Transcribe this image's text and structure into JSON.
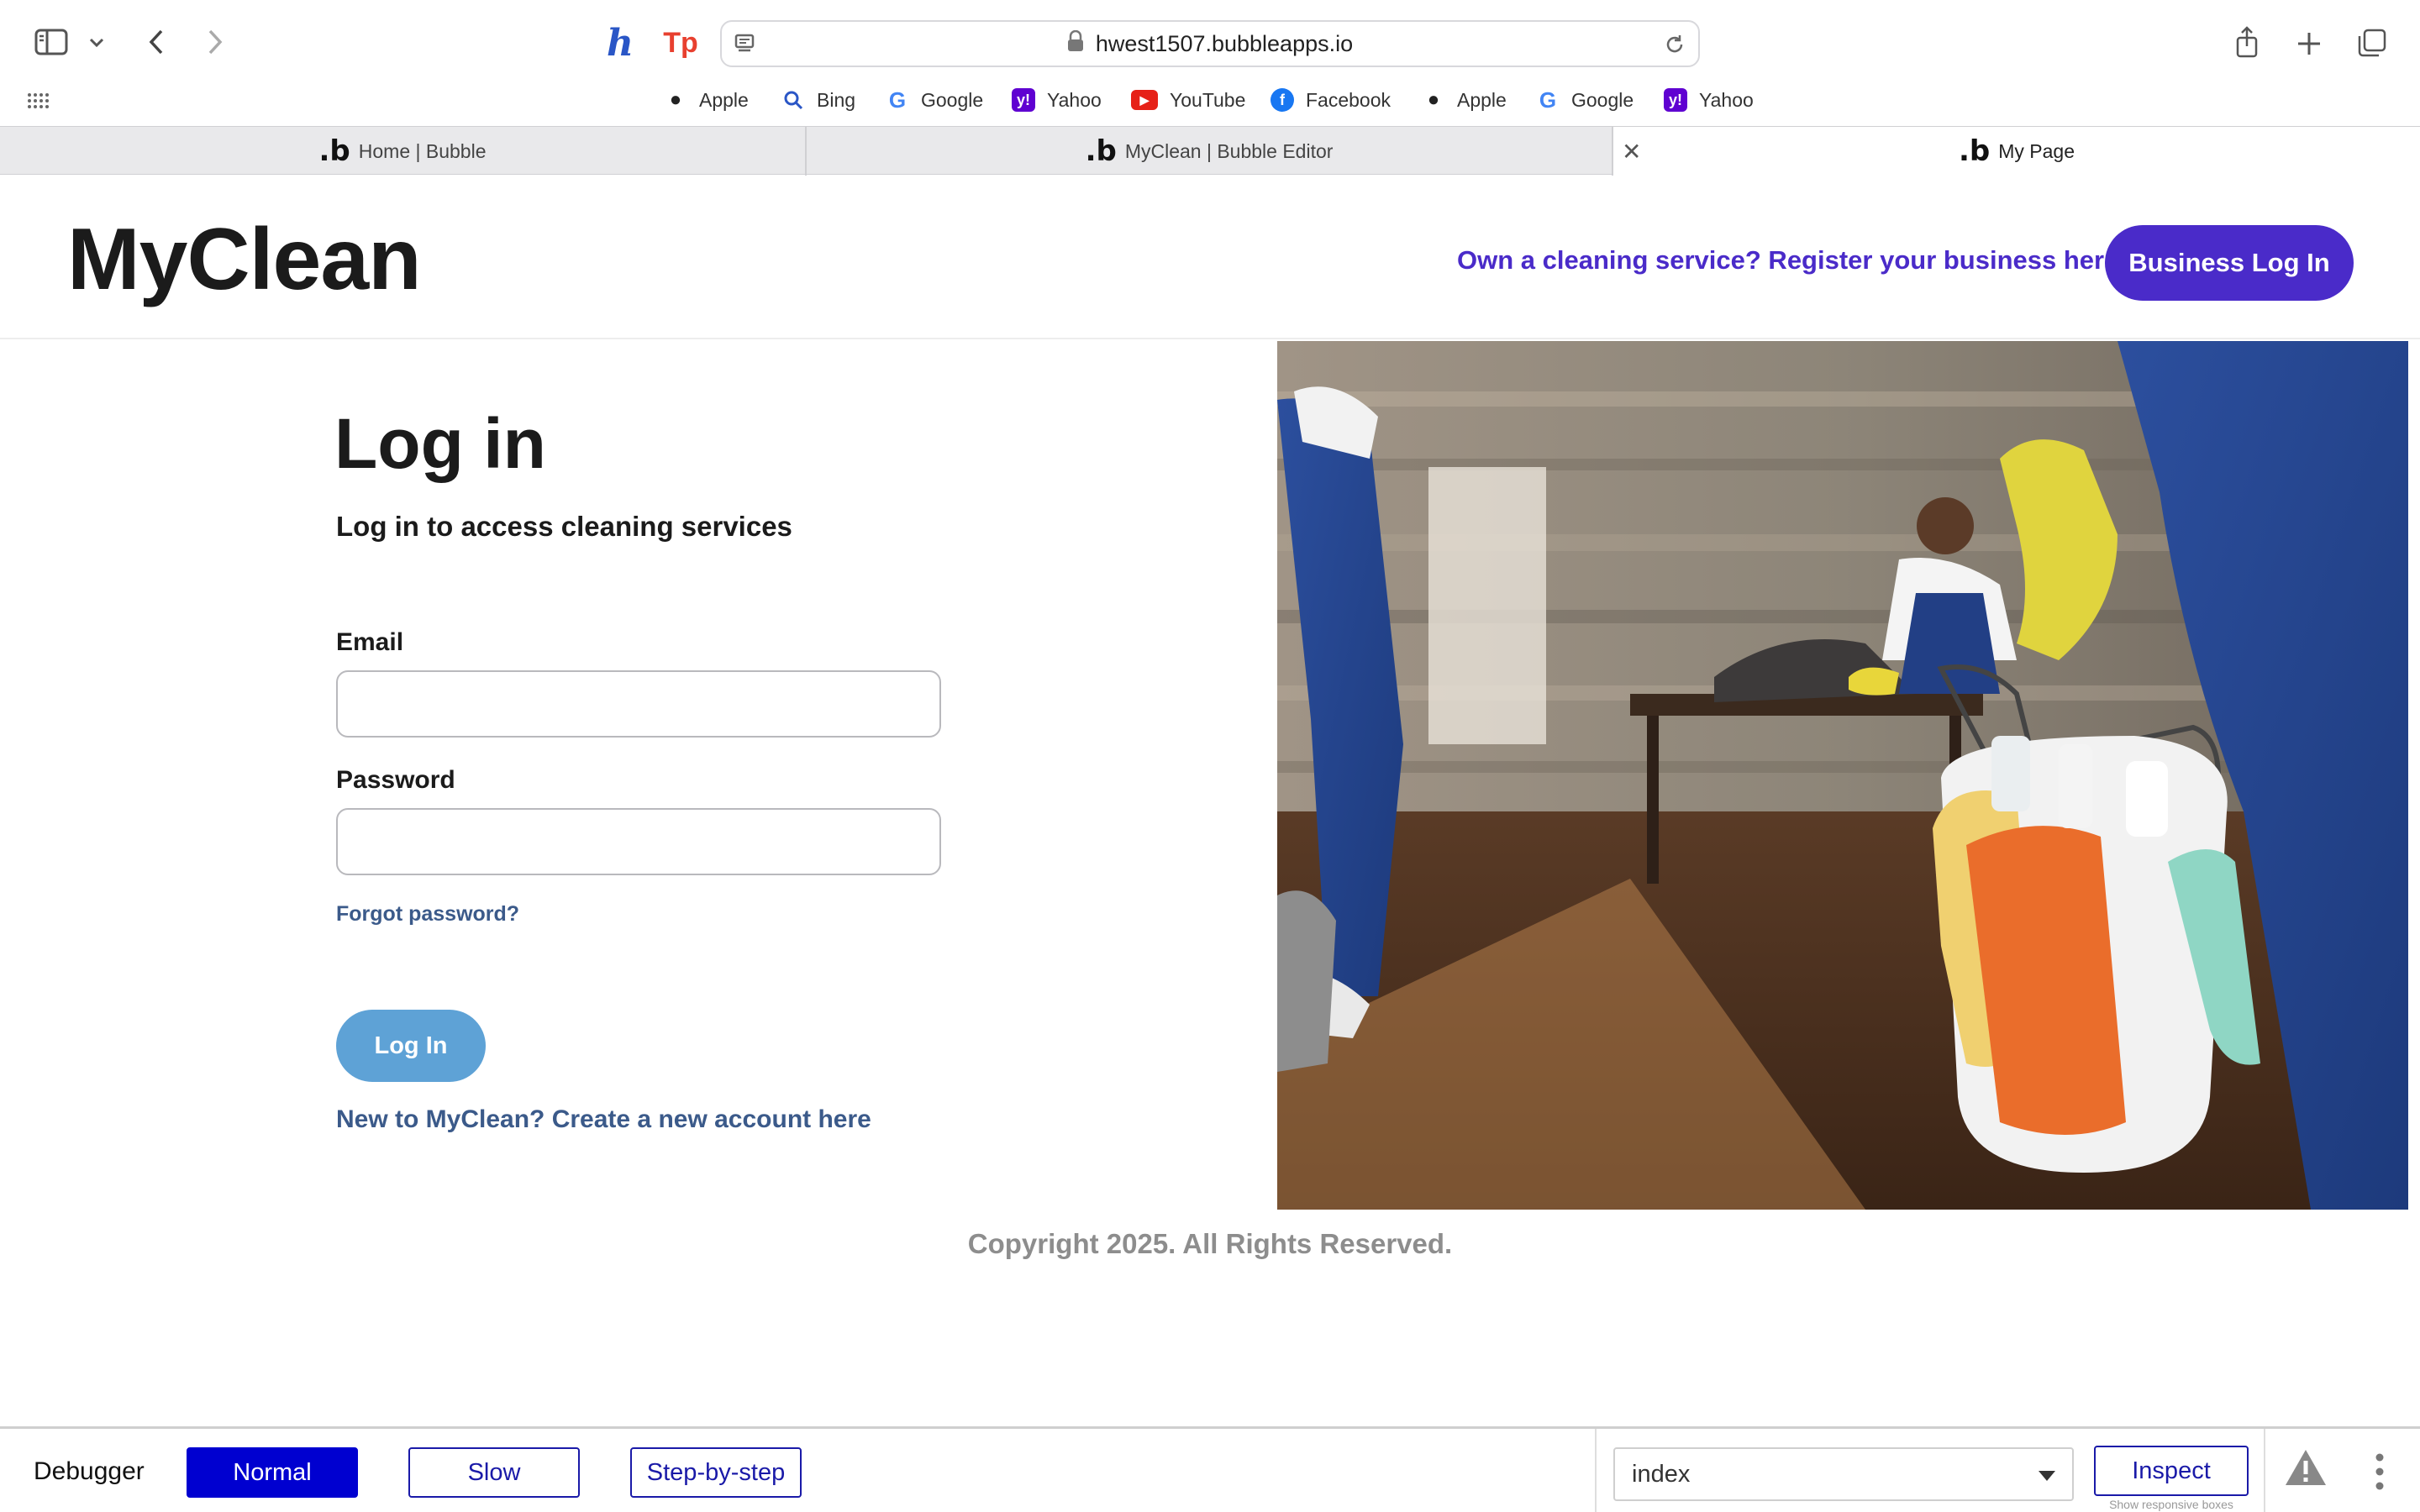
{
  "browser": {
    "url": "hwest1507.bubbleapps.io",
    "favorites": [
      {
        "label": "Apple",
        "icon": "apple-icon"
      },
      {
        "label": "Bing",
        "icon": "search-icon"
      },
      {
        "label": "Google",
        "icon": "google-icon"
      },
      {
        "label": "Yahoo",
        "icon": "yahoo-icon"
      },
      {
        "label": "YouTube",
        "icon": "youtube-icon"
      },
      {
        "label": "Facebook",
        "icon": "facebook-icon"
      },
      {
        "label": "Apple",
        "icon": "apple-icon"
      },
      {
        "label": "Google",
        "icon": "google-icon"
      },
      {
        "label": "Yahoo",
        "icon": "yahoo-icon"
      }
    ],
    "tabs": [
      {
        "label": "Home | Bubble",
        "active": false
      },
      {
        "label": "MyClean | Bubble Editor",
        "active": false
      },
      {
        "label": "My Page",
        "active": true
      }
    ]
  },
  "header": {
    "brand": "MyClean",
    "register_link": "Own a cleaning service? Register your business here.",
    "business_button": "Business Log In"
  },
  "login": {
    "title": "Log in",
    "subtitle": "Log in to access cleaning services",
    "email_label": "Email",
    "email_value": "",
    "password_label": "Password",
    "password_value": "",
    "forgot_link": "Forgot password?",
    "submit_button": "Log In",
    "signup_link": "New to MyClean? Create a new account here"
  },
  "footer": {
    "copyright": "Copyright 2025. All Rights Reserved."
  },
  "debugger": {
    "label": "Debugger",
    "modes": [
      "Normal",
      "Slow",
      "Step-by-step"
    ],
    "active_mode": "Normal",
    "page_select": "index",
    "inspect_button": "Inspect",
    "responsive_note": "Show responsive boxes"
  },
  "colors": {
    "brand_purple": "#4a2bc9",
    "login_button": "#5ea2d6",
    "link_blue": "#3b5a8a",
    "debugger_active": "#0000d0"
  }
}
